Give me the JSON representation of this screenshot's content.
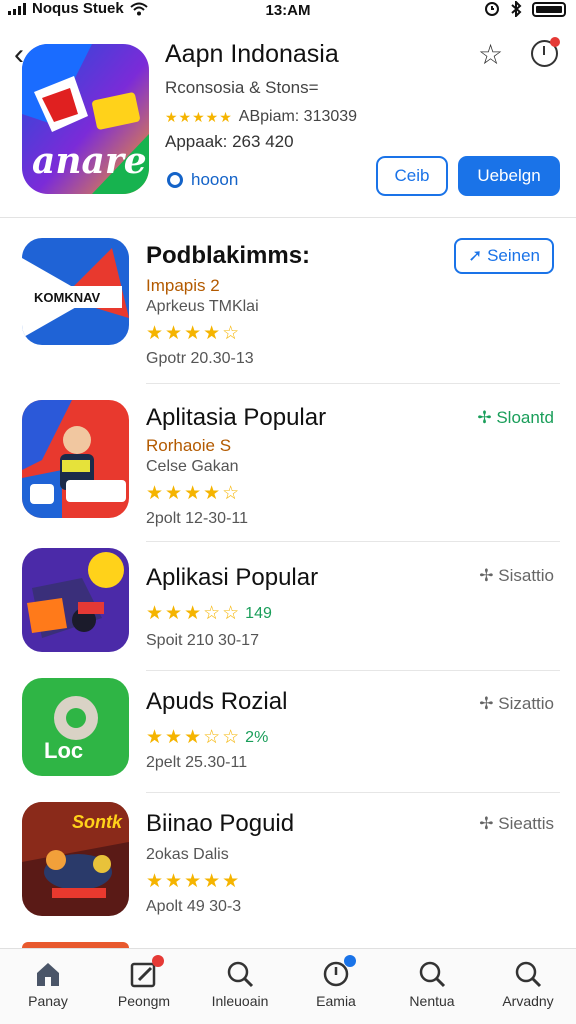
{
  "status_bar": {
    "carrier": "Noqus Stuek",
    "time": "13:AM"
  },
  "app": {
    "title": "Aapn Indonasia",
    "subtitle": "Rconsosia & Stons=",
    "rating_text": "ABpiam: 313039",
    "meta": "Appaak: 263 420",
    "link_text": "hooon",
    "button_secondary": "Ceib",
    "button_primary": "Uebelgn",
    "hero_icon_text": "anare"
  },
  "list": [
    {
      "title": "Podblakimms:",
      "line1": "Impapis 2",
      "line2": "Aprkeus TMKlai",
      "stars": "★★★★☆",
      "count": "",
      "meta": "Gpotr 20.30-13",
      "action": "Seinen",
      "action_style": "pill",
      "thumb_text": "KOMKNAV"
    },
    {
      "title": "Aplitasia Popular",
      "line1": "Rorhaoie S",
      "line2": "Celse Gakan",
      "stars": "★★★★☆",
      "count": "",
      "meta": "2polt 12-30-11",
      "action": "Sloantd",
      "action_style": "green",
      "thumb_text": ""
    },
    {
      "title": "Aplikasi Popular",
      "line1": "",
      "line2": "",
      "stars": "★★★☆☆",
      "count": "149",
      "meta": "Spoit 210 30-17",
      "action": "Sisattio",
      "action_style": "gray",
      "thumb_text": ""
    },
    {
      "title": "Apuds Rozial",
      "line1": "",
      "line2": "",
      "stars": "★★★☆☆",
      "count": "2%",
      "meta": "2pelt 25.30-11",
      "action": "Sizattio",
      "action_style": "gray",
      "thumb_text": "Loc"
    },
    {
      "title": "Biinao Poguid",
      "line1": "",
      "line2": "2okas Dalis",
      "stars": "★★★★★",
      "count": "",
      "meta": "Apolt 49 30-3",
      "action": "Sieattis",
      "action_style": "gray",
      "thumb_text": "Sontk"
    }
  ],
  "tabs": [
    {
      "label": "Panay",
      "icon": "home-icon"
    },
    {
      "label": "Peongm",
      "icon": "edit-icon"
    },
    {
      "label": "Inleuoain",
      "icon": "search-icon"
    },
    {
      "label": "Eamia",
      "icon": "clock-icon"
    },
    {
      "label": "Nentua",
      "icon": "search-icon"
    },
    {
      "label": "Arvadny",
      "icon": "search-icon"
    }
  ],
  "colors": {
    "accent": "#1a73e8",
    "star": "#f5b400",
    "green": "#1a9e5a"
  }
}
